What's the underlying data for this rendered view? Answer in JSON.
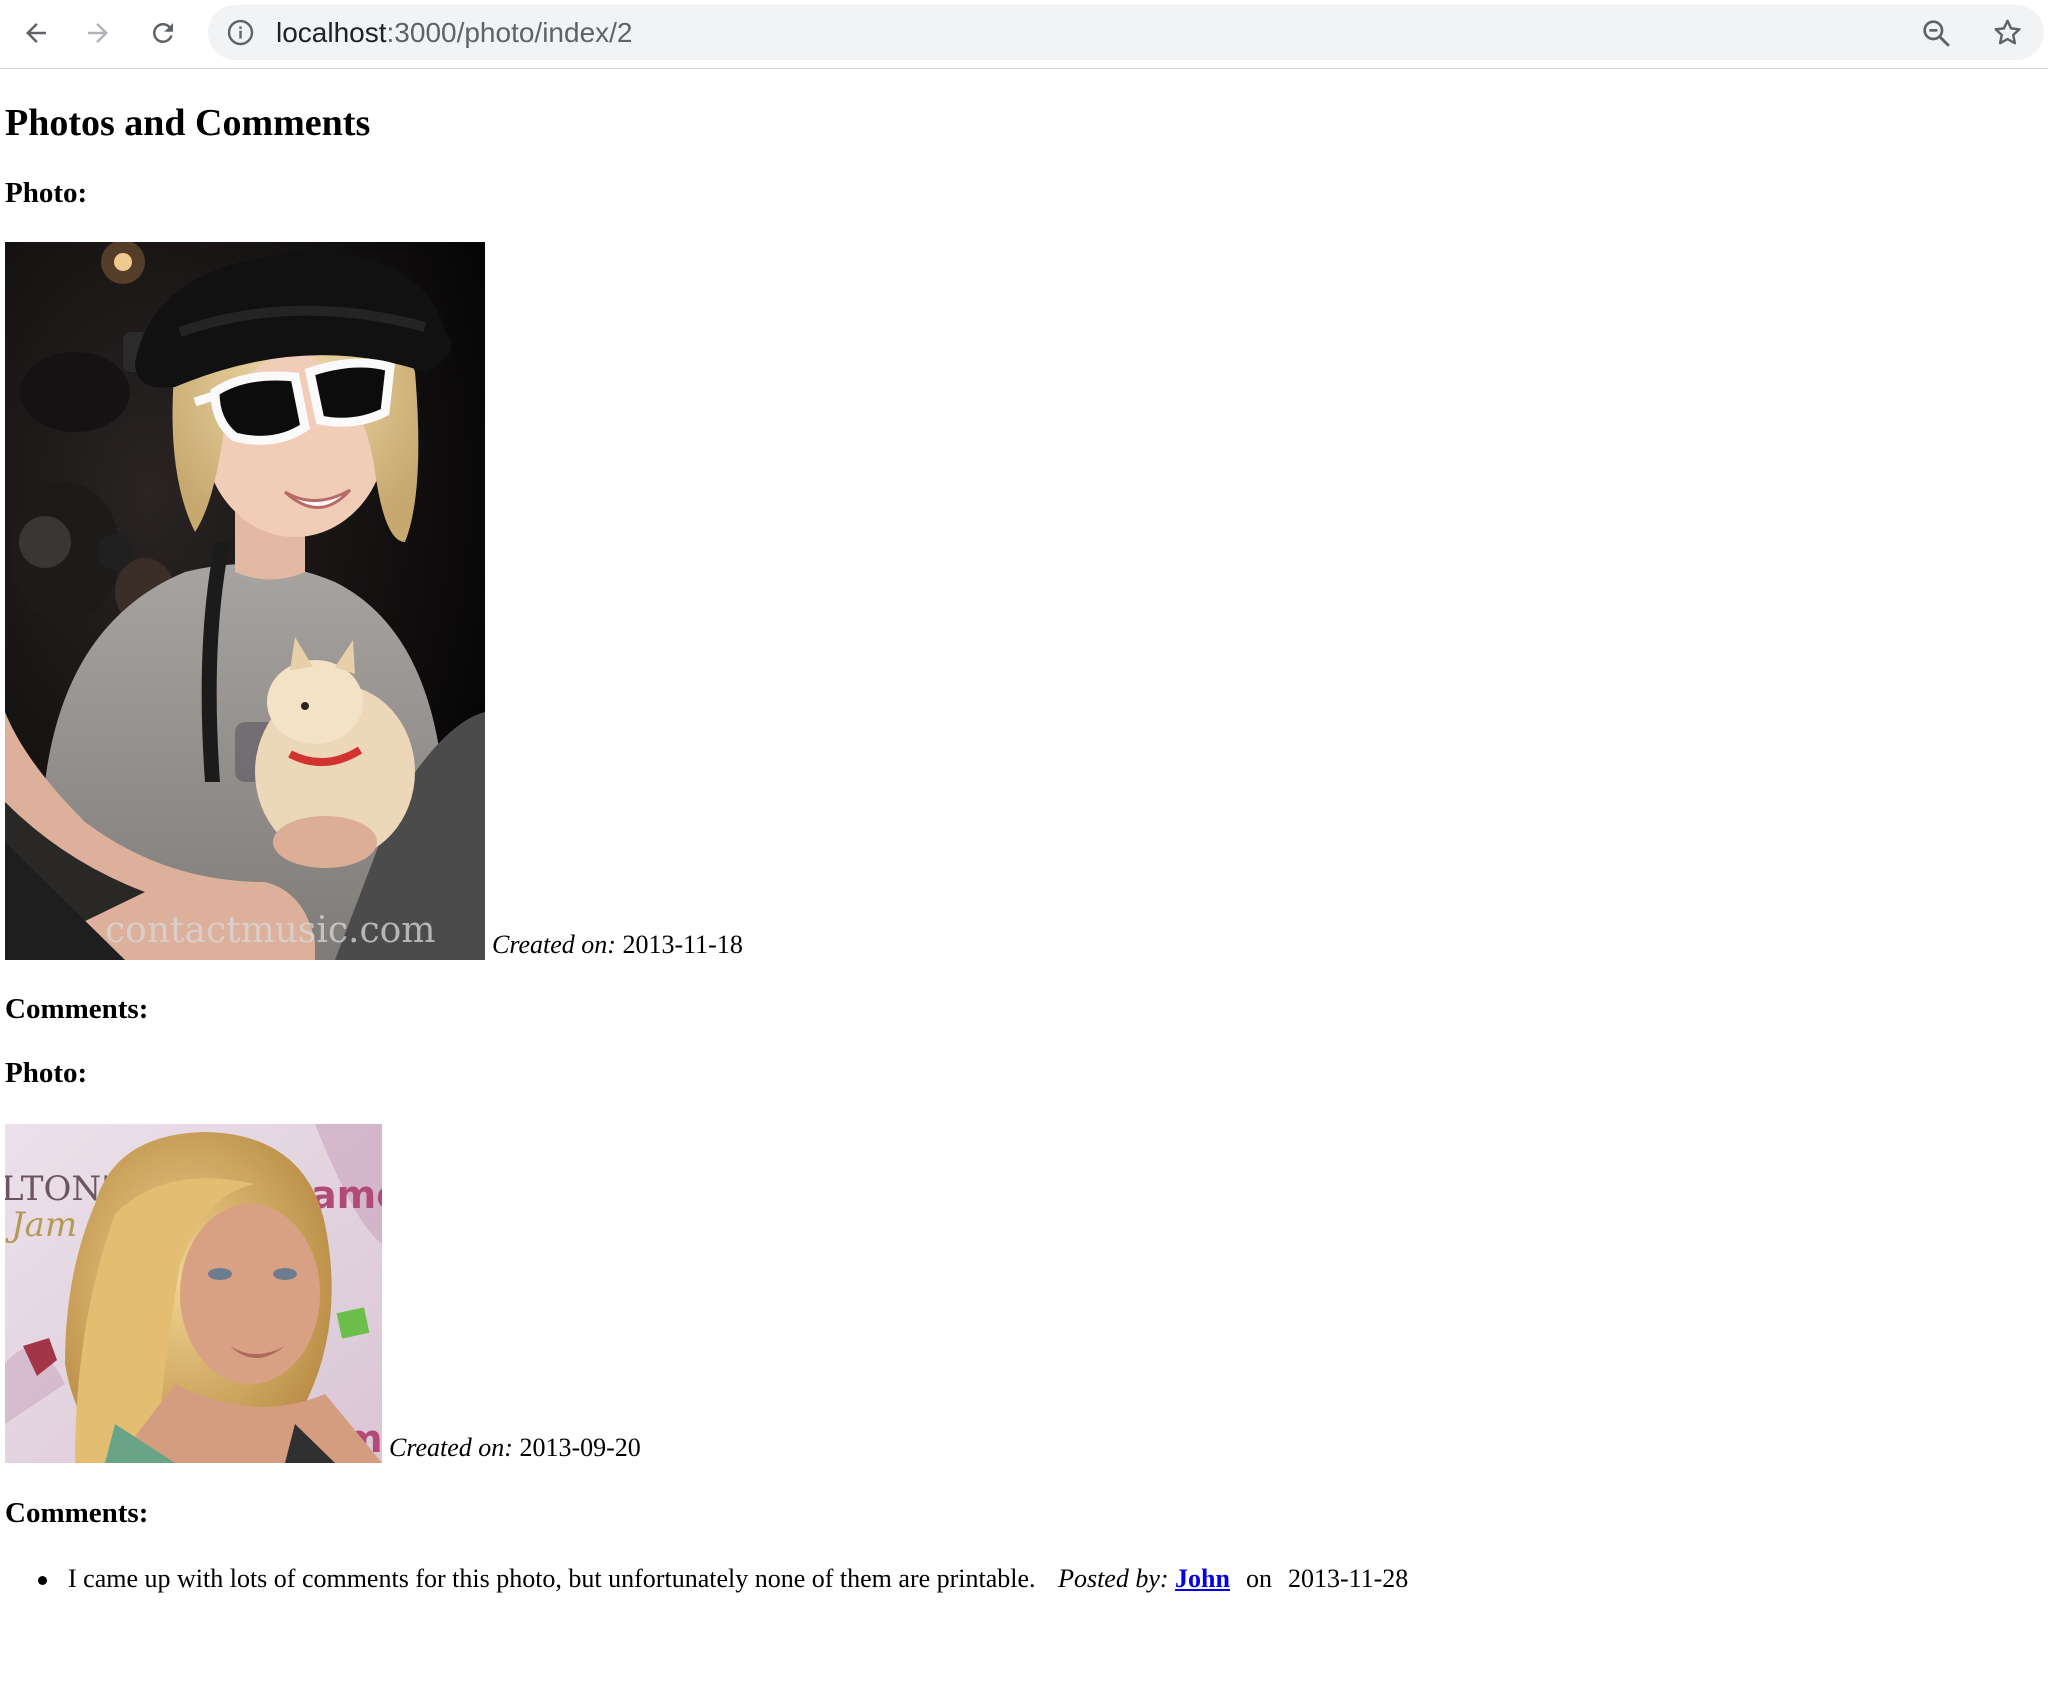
{
  "browser": {
    "url_host": "localhost",
    "url_path": ":3000/photo/index/2",
    "icons": {
      "back": "arrow-left-icon",
      "forward": "arrow-right-icon",
      "reload": "reload-icon",
      "site_info": "info-icon",
      "zoom": "zoom-out-icon",
      "bookmark": "star-icon"
    }
  },
  "page": {
    "title": "Photos and Comments",
    "photos": [
      {
        "heading": "Photo:",
        "created_label": "Created on:",
        "created_date": "2013-11-18",
        "watermark": "contactmusic.com",
        "comments_heading": "Comments:",
        "comments": []
      },
      {
        "heading": "Photo:",
        "created_label": "Created on:",
        "created_date": "2013-09-20",
        "backdrop_text_1": "LTON'S",
        "backdrop_text_2": "Jam",
        "backdrop_text_3": "amo",
        "backdrop_text_4": "m",
        "comments_heading": "Comments:",
        "comments": [
          {
            "text": "I came up with lots of comments for this photo, but unfortunately none of them are printable.",
            "posted_label": "Posted by:",
            "author": "John",
            "on_label": "on",
            "date": "2013-11-28"
          }
        ]
      }
    ]
  },
  "colors": {
    "link": "#0000ee",
    "omnibox_bg": "#f1f3f4",
    "icon_gray": "#5f6368"
  }
}
